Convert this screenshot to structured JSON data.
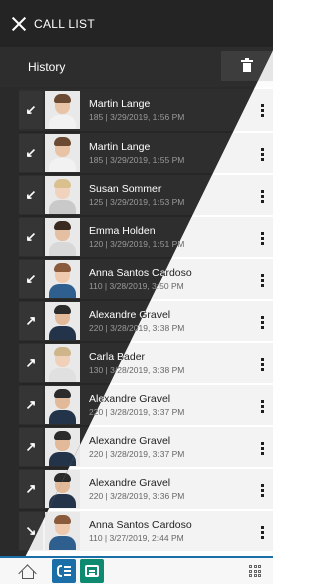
{
  "header": {
    "title": "CALL LIST",
    "close_icon": "close-icon"
  },
  "history": {
    "label": "History",
    "delete_icon": "trash-icon"
  },
  "calls": [
    {
      "name": "Martin Lange",
      "number": "185",
      "datetime": "3/29/2019, 1:56 PM",
      "direction": "incoming",
      "icon": "incoming-arrow-icon"
    },
    {
      "name": "Martin Lange",
      "number": "185",
      "datetime": "3/29/2019, 1:55 PM",
      "direction": "incoming",
      "icon": "incoming-arrow-icon"
    },
    {
      "name": "Susan Sommer",
      "number": "125",
      "datetime": "3/29/2019, 1:53 PM",
      "direction": "incoming",
      "icon": "incoming-arrow-icon"
    },
    {
      "name": "Emma Holden",
      "number": "120",
      "datetime": "3/29/2019, 1:51 PM",
      "direction": "incoming",
      "icon": "incoming-arrow-icon"
    },
    {
      "name": "Anna Santos Cardoso",
      "number": "110",
      "datetime": "3/28/2019, 3:50 PM",
      "direction": "incoming",
      "icon": "incoming-arrow-icon"
    },
    {
      "name": "Alexandre Gravel",
      "number": "220",
      "datetime": "3/28/2019, 3:38 PM",
      "direction": "outgoing",
      "icon": "outgoing-arrow-icon"
    },
    {
      "name": "Carla Bader",
      "number": "130",
      "datetime": "3/28/2019, 3:38 PM",
      "direction": "outgoing",
      "icon": "outgoing-arrow-icon"
    },
    {
      "name": "Alexandre Gravel",
      "number": "220",
      "datetime": "3/28/2019, 3:37 PM",
      "direction": "outgoing",
      "icon": "outgoing-arrow-icon"
    },
    {
      "name": "Alexandre Gravel",
      "number": "220",
      "datetime": "3/28/2019, 3:37 PM",
      "direction": "outgoing",
      "icon": "outgoing-arrow-icon"
    },
    {
      "name": "Alexandre Gravel",
      "number": "220",
      "datetime": "3/28/2019, 3:36 PM",
      "direction": "outgoing",
      "icon": "outgoing-arrow-icon"
    },
    {
      "name": "Anna Santos Cardoso",
      "number": "110",
      "datetime": "3/27/2019, 2:44 PM",
      "direction": "missed",
      "icon": "missed-call-icon"
    }
  ],
  "bottom_nav": {
    "items": [
      {
        "name": "home",
        "icon": "home-icon"
      },
      {
        "name": "call-list",
        "icon": "call-list-icon",
        "active": true
      },
      {
        "name": "chat",
        "icon": "chat-icon"
      },
      {
        "name": "apps",
        "icon": "grid-icon"
      }
    ]
  },
  "colors": {
    "accent_blue": "#1a6fa8",
    "chat_green": "#0e8a71",
    "missed_red": "#d0283a",
    "dark_bg": "#2a2a2a",
    "light_bg": "#ffffff"
  }
}
